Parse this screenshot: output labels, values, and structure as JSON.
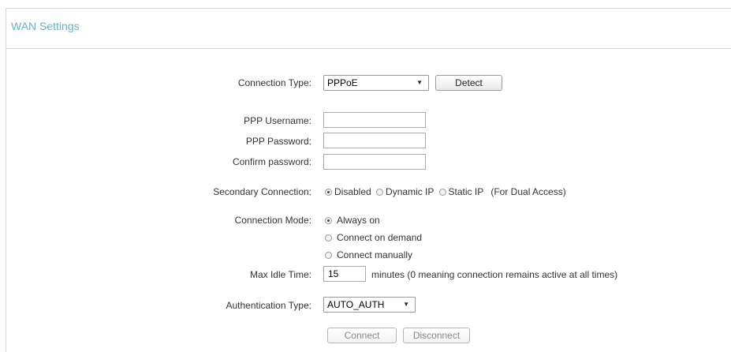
{
  "panel": {
    "title": "WAN Settings"
  },
  "connection_type": {
    "label": "Connection Type:",
    "value": "PPPoE",
    "detect_label": "Detect"
  },
  "ppp": {
    "username_label": "PPP Username:",
    "password_label": "PPP Password:",
    "confirm_label": "Confirm password:",
    "username_value": "",
    "password_value": "",
    "confirm_value": ""
  },
  "secondary": {
    "label": "Secondary Connection:",
    "options": [
      "Disabled",
      "Dynamic IP",
      "Static IP"
    ],
    "selected": "Disabled",
    "note": "(For Dual Access)"
  },
  "mode": {
    "label": "Connection Mode:",
    "options": [
      "Always on",
      "Connect on demand",
      "Connect manually"
    ],
    "selected": "Always on"
  },
  "idle": {
    "label": "Max Idle Time:",
    "value": "15",
    "suffix": "minutes (0 meaning connection remains active at all times)"
  },
  "auth": {
    "label": "Authentication Type:",
    "value": "AUTO_AUTH"
  },
  "actions": {
    "connect_label": "Connect",
    "disconnect_label": "Disconnect"
  }
}
